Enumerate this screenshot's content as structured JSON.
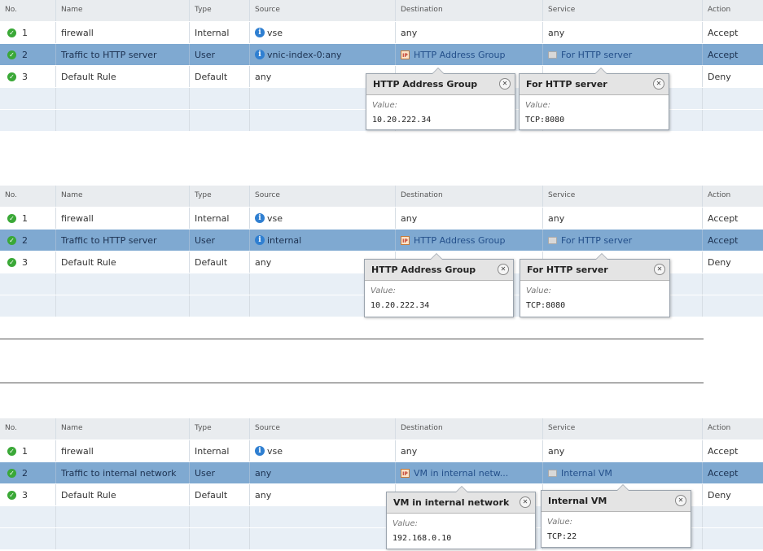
{
  "headers": [
    "No.",
    "Name",
    "Type",
    "Source",
    "Destination",
    "Service",
    "Action"
  ],
  "panels": [
    {
      "rows": [
        {
          "no": "1",
          "name": "firewall",
          "type": "Internal",
          "source": "vse",
          "source_icon": "info-icon",
          "destination": "any",
          "service": "any",
          "action": "Accept"
        },
        {
          "no": "2",
          "name": "Traffic to HTTP server",
          "type": "User",
          "source": "vnic-index-0:any",
          "source_icon": "info-icon",
          "destination": "HTTP Address Group",
          "service": "For HTTP server",
          "action": "Accept"
        },
        {
          "no": "3",
          "name": "Default Rule",
          "type": "Default",
          "source": "any",
          "destination": "",
          "service": "",
          "action": "Deny"
        }
      ],
      "popups": [
        {
          "title": "HTTP Address Group",
          "label": "Value:",
          "value": "10.20.222.34"
        },
        {
          "title": "For HTTP server",
          "label": "Value:",
          "value": "TCP:8080"
        }
      ]
    },
    {
      "rows": [
        {
          "no": "1",
          "name": "firewall",
          "type": "Internal",
          "source": "vse",
          "source_icon": "info-icon",
          "destination": "any",
          "service": "any",
          "action": "Accept"
        },
        {
          "no": "2",
          "name": "Traffic to HTTP server",
          "type": "User",
          "source": "internal",
          "source_icon": "info-icon",
          "destination": "HTTP Address Group",
          "service": "For HTTP server",
          "action": "Accept"
        },
        {
          "no": "3",
          "name": "Default Rule",
          "type": "Default",
          "source": "any",
          "destination": "",
          "service": "",
          "action": "Deny"
        }
      ],
      "popups": [
        {
          "title": "HTTP Address Group",
          "label": "Value:",
          "value": "10.20.222.34"
        },
        {
          "title": "For HTTP server",
          "label": "Value:",
          "value": "TCP:8080"
        }
      ]
    },
    {
      "rows": [
        {
          "no": "1",
          "name": "firewall",
          "type": "Internal",
          "source": "vse",
          "source_icon": "info-icon",
          "destination": "any",
          "service": "any",
          "action": "Accept"
        },
        {
          "no": "2",
          "name": "Traffic to internal network",
          "type": "User",
          "source": "any",
          "destination": "VM in internal netw...",
          "service": "Internal VM",
          "action": "Accept"
        },
        {
          "no": "3",
          "name": "Default Rule",
          "type": "Default",
          "source": "any",
          "destination": "",
          "service": "",
          "action": "Deny"
        }
      ],
      "popups": [
        {
          "title": "VM in internal network",
          "label": "Value:",
          "value": "192.168.0.10"
        },
        {
          "title": "Internal VM",
          "label": "Value:",
          "value": "TCP:22"
        }
      ]
    }
  ],
  "colors": {
    "selected_row": "#7fa9d1",
    "alt_row": "#e8eff6",
    "accept_check": "#3aa837",
    "info": "#2f7fd1"
  },
  "icons": {
    "row_status": "check-icon",
    "address_group": "ip-set-icon",
    "service": "service-icon",
    "close": "close-icon"
  }
}
